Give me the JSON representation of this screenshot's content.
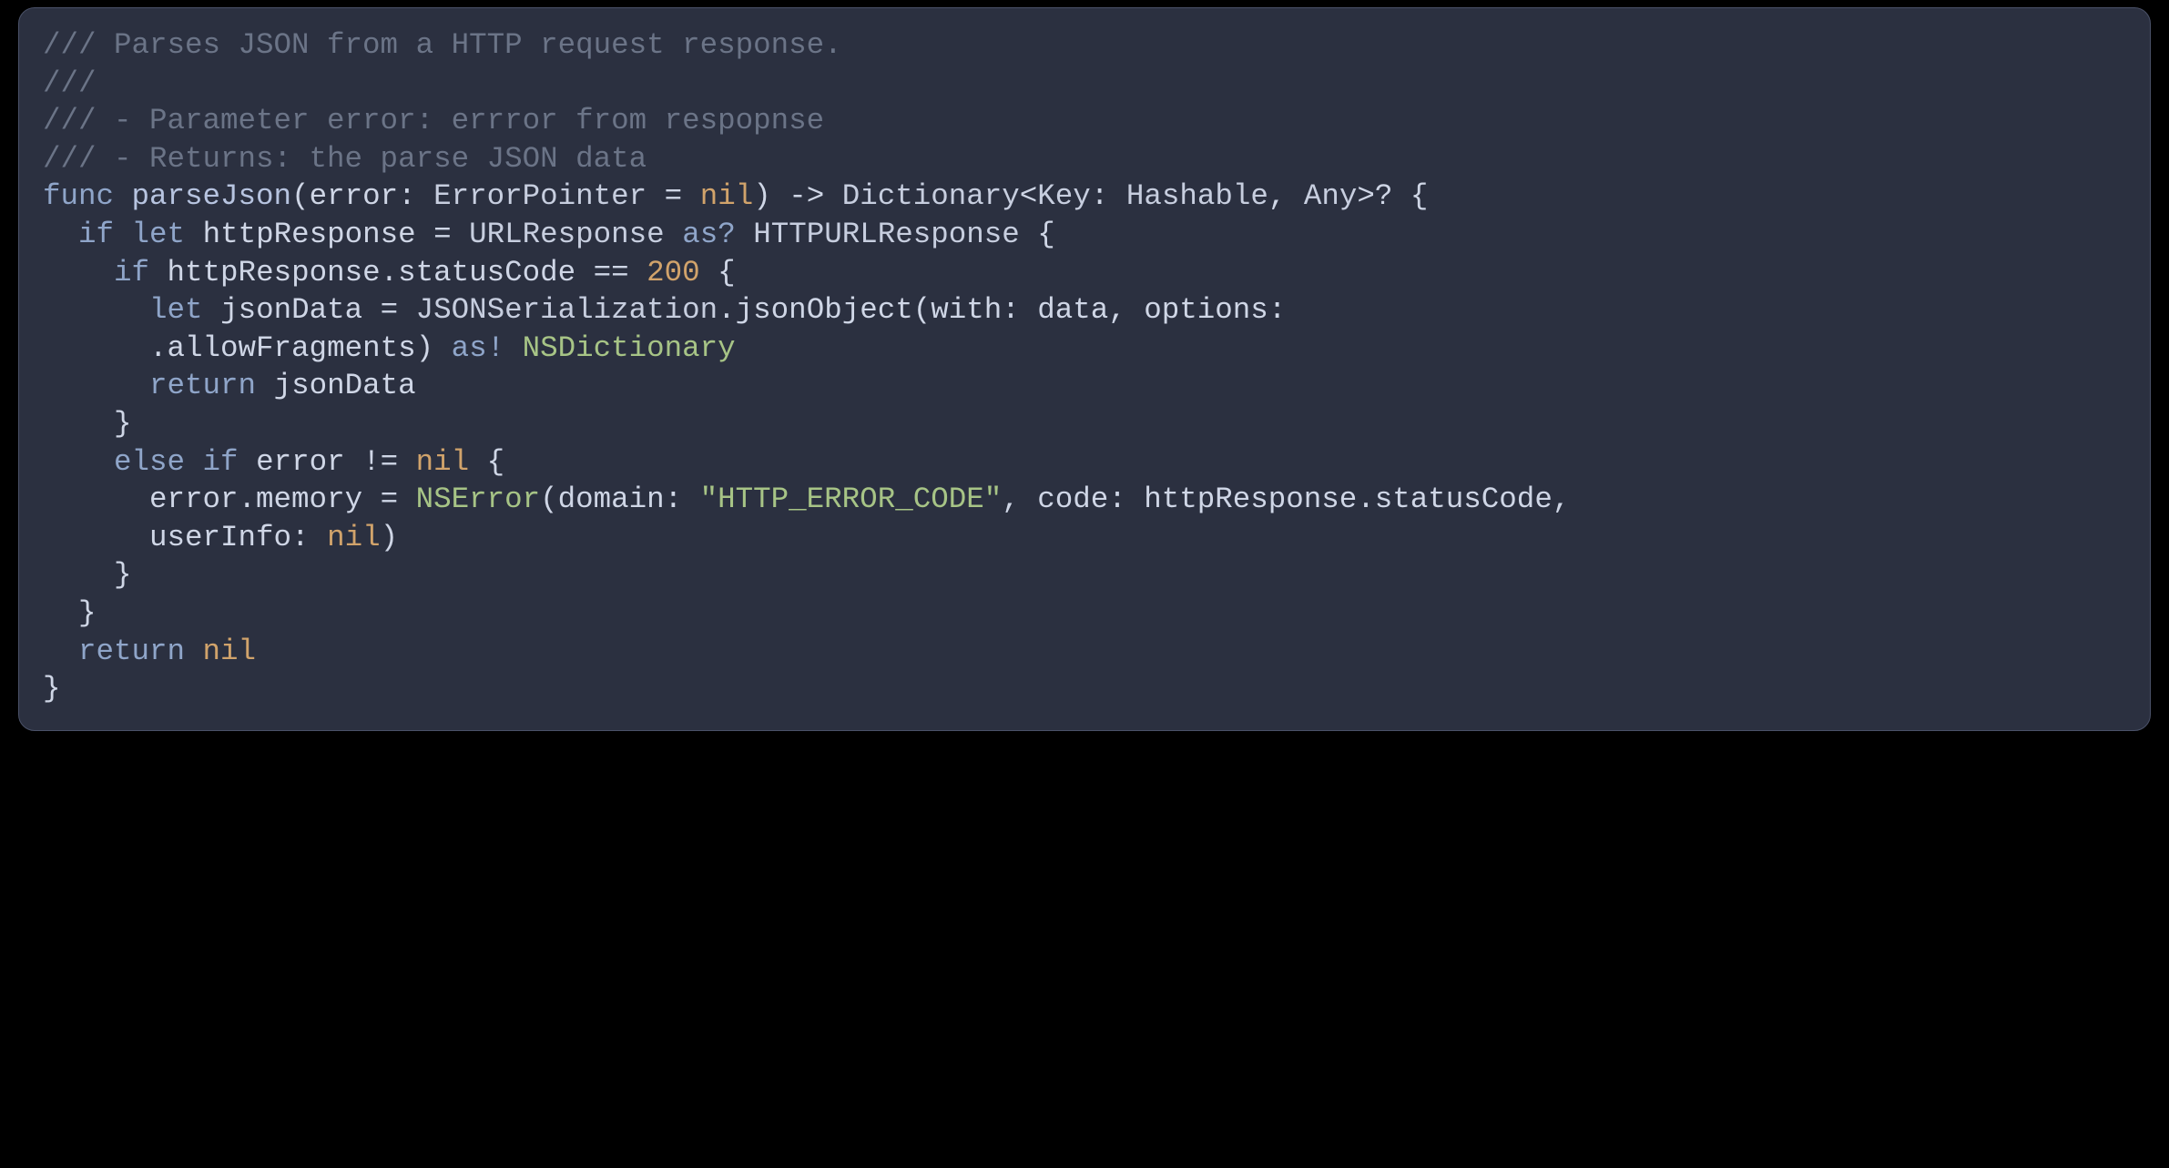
{
  "code": {
    "c1": "/// Parses JSON from a HTTP request response.",
    "c2": "///",
    "c3": "/// - Parameter error: errror from respopnse",
    "c4": "/// - Returns: the parse JSON data",
    "k_func": "func",
    "fn_name": "parseJson",
    "lparen": "(",
    "p_error": "error",
    "colon1": ": ",
    "t_ErrorPointer": "ErrorPointer",
    "eq1": " = ",
    "nil1": "nil",
    "rparen": ")",
    "arrow": " -> ",
    "t_Dictionary": "Dictionary",
    "lt": "<",
    "t_Key": "Key",
    "colon2": ": ",
    "t_Hashable": "Hashable",
    "comma1": ", ",
    "t_Any": "Any",
    "gt": ">",
    "qmark": "?",
    "brace_open": " {",
    "indent1": "  ",
    "k_if1": "if",
    "sp": " ",
    "k_let1": "let",
    "v_httpResponse": "httpResponse",
    "eq2": " = ",
    "t_URLResponse": "URLResponse",
    "k_asq": "as?",
    "t_HTTPURLResponse": "HTTPURLResponse",
    "brace_open2": " {",
    "indent2": "    ",
    "k_if2": "if",
    "expr_status_l": "httpResponse.statusCode ",
    "eqeq": "==",
    "num200": " 200",
    "brace_open3": " {",
    "indent3": "      ",
    "k_let2": "let",
    "v_jsonData": "jsonData",
    "eq3": " = ",
    "t_JSONSer": "JSONSerialization",
    "dot_jsonObject": ".jsonObject(",
    "lbl_with": "with",
    "colon3": ": ",
    "v_data": "data",
    "comma2": ", ",
    "lbl_options": "options",
    "colon4": ":",
    "line_wrap_indent": "      ",
    "dot_allowFragments": ".allowFragments) ",
    "k_asbang": "as!",
    "t_NSDictionary": " NSDictionary",
    "k_return1": "return",
    "v_jsonData2": " jsonData",
    "brace_close3": "    }",
    "k_else": "else",
    "k_if3": "if",
    "v_error": " error ",
    "neq": "!=",
    "nil2": " nil",
    "brace_open4": " {",
    "l_errmem": "error.memory = ",
    "t_NSError": "NSError",
    "l_domain": "(domain: ",
    "s_httperr": "\"HTTP_ERROR_CODE\"",
    "l_code": ", code: httpResponse.statusCode,",
    "l_userinfo": "userInfo: ",
    "nil3": "nil",
    "rparen2": ")",
    "brace_close4": "    }",
    "brace_close2": "  }",
    "k_return2": "return",
    "nil4": " nil",
    "brace_close1": "}"
  }
}
